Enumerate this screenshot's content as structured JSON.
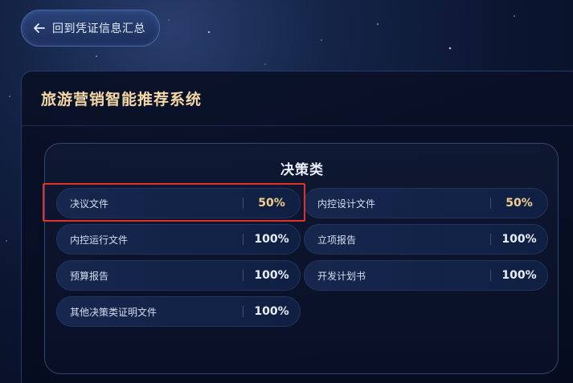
{
  "back_button": {
    "label": "回到凭证信息汇总",
    "icon": "arrow-left-icon"
  },
  "panel": {
    "title": "旅游营销智能推荐系统"
  },
  "section": {
    "title": "决策类",
    "items": [
      {
        "name": "决议文件",
        "percent": "50%"
      },
      {
        "name": "内控设计文件",
        "percent": "50%"
      },
      {
        "name": "内控运行文件",
        "percent": "100%"
      },
      {
        "name": "立项报告",
        "percent": "100%"
      },
      {
        "name": "预算报告",
        "percent": "100%"
      },
      {
        "name": "开发计划书",
        "percent": "100%"
      },
      {
        "name": "其他决策类证明文件",
        "percent": "100%"
      }
    ]
  },
  "colors": {
    "title_gold": "#f3d8a6",
    "partial_percent": "#f2cf8d",
    "highlight_border": "#e0312a"
  }
}
